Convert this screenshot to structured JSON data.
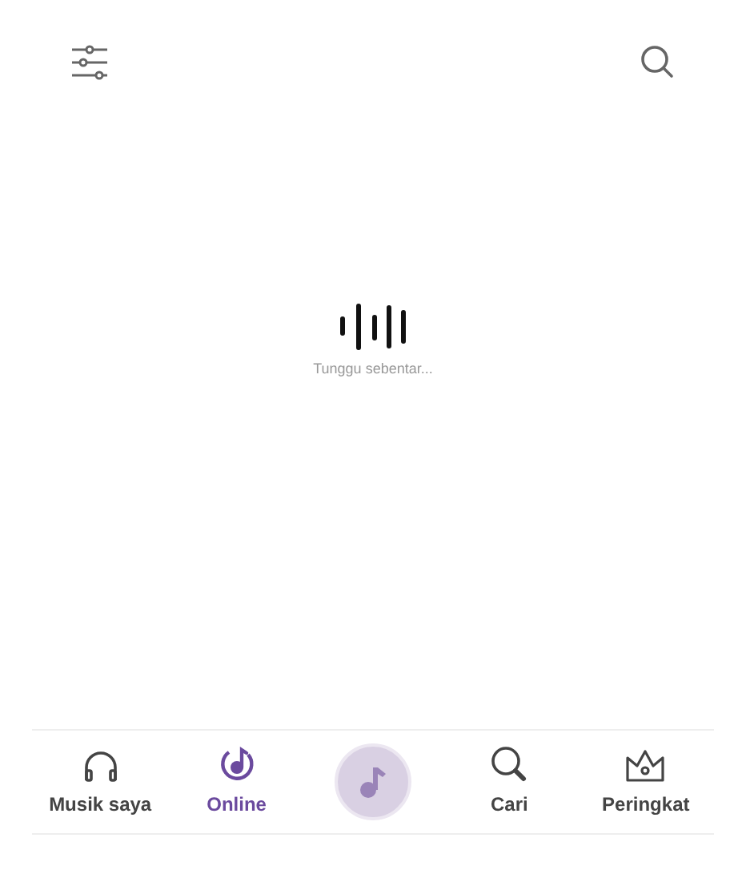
{
  "loading": {
    "message": "Tunggu sebentar..."
  },
  "nav": [
    {
      "kind": "tab",
      "label": "Musik saya",
      "selected": false
    },
    {
      "kind": "tab",
      "label": "Online",
      "selected": true
    },
    {
      "kind": "player"
    },
    {
      "kind": "tab",
      "label": "Cari",
      "selected": false
    },
    {
      "kind": "tab",
      "label": "Peringkat",
      "selected": false
    }
  ]
}
